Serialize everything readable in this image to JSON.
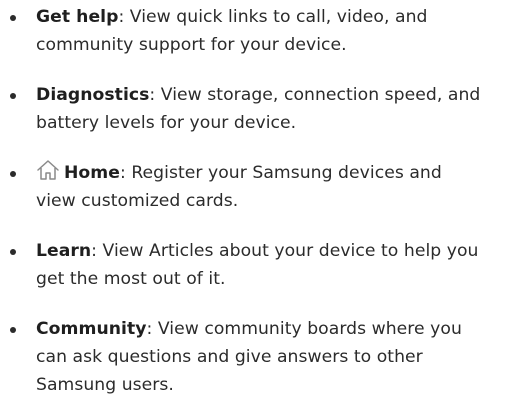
{
  "items": [
    {
      "term": "Get help",
      "line1": ": View quick links to call, video, and",
      "line2": "community support for your device."
    },
    {
      "term": "Diagnostics",
      "line1": ": View storage, connection speed, and",
      "line2": "battery levels for your device."
    },
    {
      "icon": "home-icon",
      "term": "Home",
      "line1": ": Register your Samsung devices and",
      "line2": "view customized cards."
    },
    {
      "term": "Learn",
      "line1": ": View Articles about your device to help you",
      "line2": "get the most out of it."
    },
    {
      "term": "Community",
      "line1": ": View community boards where you",
      "line2": "can ask questions and give answers to other",
      "line3": "Samsung users."
    }
  ]
}
